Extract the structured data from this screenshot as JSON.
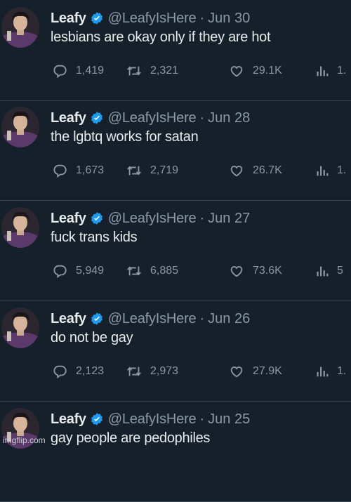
{
  "tweets": [
    {
      "name": "Leafy",
      "handle": "@LeafyIsHere",
      "separator": "·",
      "date": "Jun 30",
      "text": "lesbians are okay only if they are hot",
      "replies": "1,419",
      "retweets": "2,321",
      "likes": "29.1K",
      "views": "1."
    },
    {
      "name": "Leafy",
      "handle": "@LeafyIsHere",
      "separator": "·",
      "date": "Jun 28",
      "text": "the lgbtq works for satan",
      "replies": "1,673",
      "retweets": "2,719",
      "likes": "26.7K",
      "views": "1."
    },
    {
      "name": "Leafy",
      "handle": "@LeafyIsHere",
      "separator": "·",
      "date": "Jun 27",
      "text": "fuck trans kids",
      "replies": "5,949",
      "retweets": "6,885",
      "likes": "73.6K",
      "views": "5"
    },
    {
      "name": "Leafy",
      "handle": "@LeafyIsHere",
      "separator": "·",
      "date": "Jun 26",
      "text": "do not be gay",
      "replies": "2,123",
      "retweets": "2,973",
      "likes": "27.9K",
      "views": "1."
    },
    {
      "name": "Leafy",
      "handle": "@LeafyIsHere",
      "separator": "·",
      "date": "Jun 25",
      "text": "gay people are pedophiles",
      "replies": "",
      "retweets": "",
      "likes": "",
      "views": ""
    }
  ],
  "icons": {
    "verified": "verified-badge-icon",
    "reply": "reply-icon",
    "retweet": "retweet-icon",
    "like": "heart-icon",
    "views": "views-chart-icon"
  },
  "colors": {
    "background": "#15202b",
    "text": "#e7e9ea",
    "muted": "#8b98a5",
    "verified": "#1d9bf0",
    "divider": "#38444d"
  },
  "watermark": "imgflip.com"
}
